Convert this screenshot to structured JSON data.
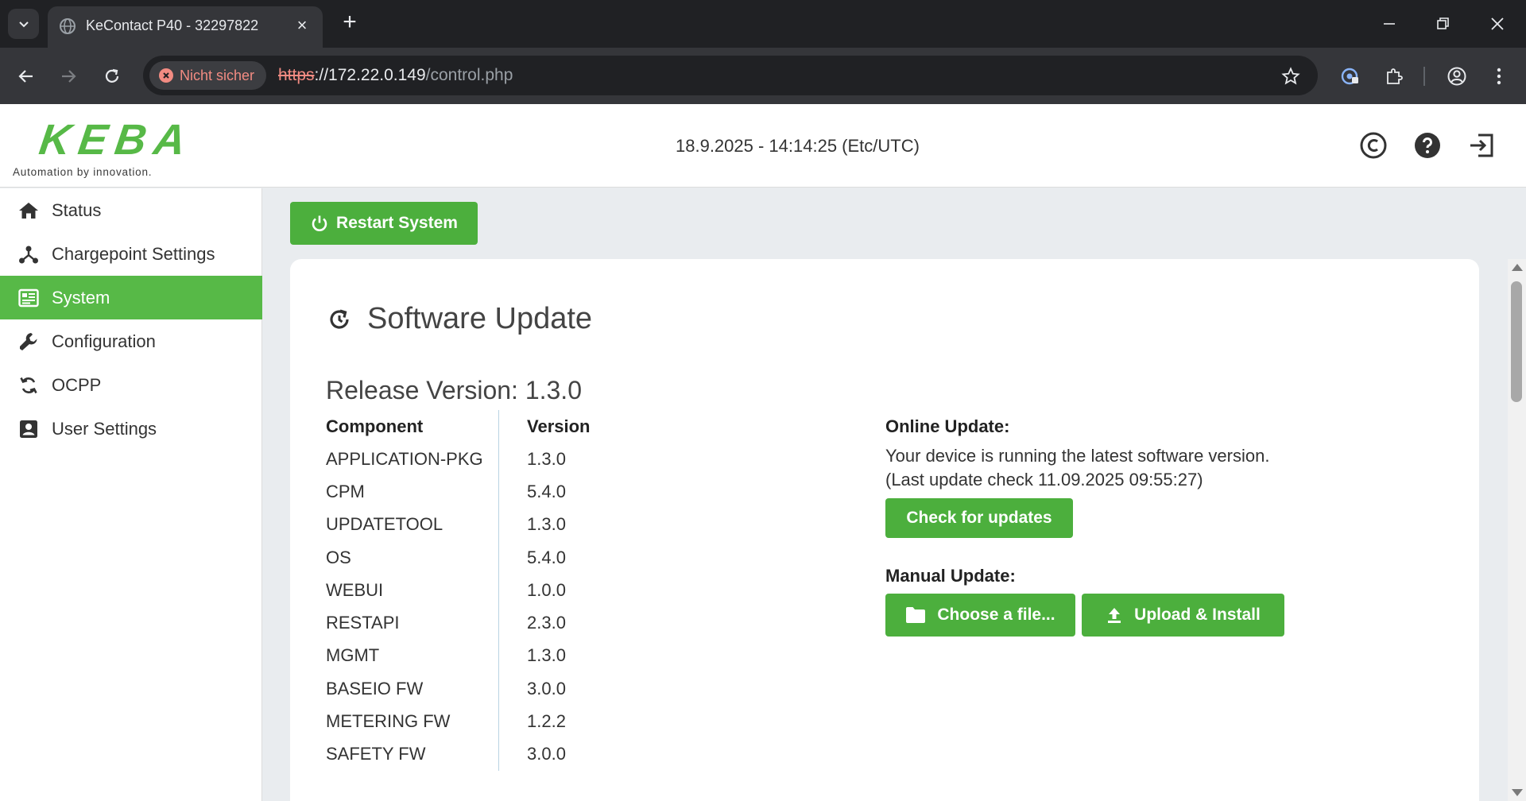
{
  "browser": {
    "tab_title": "KeContact P40 - 32297822",
    "security_label": "Nicht sicher",
    "url_scheme": "https",
    "url_host": "://172.22.0.149",
    "url_path": "/control.php"
  },
  "header": {
    "logo_text": "KEBA",
    "logo_tagline": "Automation by innovation.",
    "datetime": "18.9.2025 - 14:14:25 (Etc/UTC)",
    "icons": [
      "copyright-icon",
      "help-icon",
      "logout-icon"
    ]
  },
  "sidebar": {
    "items": [
      {
        "label": "Status",
        "icon": "home-icon",
        "active": false
      },
      {
        "label": "Chargepoint Settings",
        "icon": "network-icon",
        "active": false
      },
      {
        "label": "System",
        "icon": "system-icon",
        "active": true
      },
      {
        "label": "Configuration",
        "icon": "wrench-icon",
        "active": false
      },
      {
        "label": "OCPP",
        "icon": "sync-icon",
        "active": false
      },
      {
        "label": "User Settings",
        "icon": "user-card-icon",
        "active": false
      }
    ]
  },
  "main": {
    "restart_label": "Restart System",
    "section_title": "Software Update",
    "release_version": "Release Version: 1.3.0",
    "table": {
      "headers": [
        "Component",
        "Version"
      ],
      "rows": [
        [
          "APPLICATION-PKG",
          "1.3.0"
        ],
        [
          "CPM",
          "5.4.0"
        ],
        [
          "UPDATETOOL",
          "1.3.0"
        ],
        [
          "OS",
          "5.4.0"
        ],
        [
          "WEBUI",
          "1.0.0"
        ],
        [
          "RESTAPI",
          "2.3.0"
        ],
        [
          "MGMT",
          "1.3.0"
        ],
        [
          "BASEIO FW",
          "3.0.0"
        ],
        [
          "METERING FW",
          "1.2.2"
        ],
        [
          "SAFETY FW",
          "3.0.0"
        ]
      ]
    },
    "online_update": {
      "heading": "Online Update:",
      "message": "Your device is running the latest software version.",
      "last_check": "(Last update check 11.09.2025 09:55:27)",
      "button": "Check for updates"
    },
    "manual_update": {
      "heading": "Manual Update:",
      "choose_button": "Choose a file...",
      "upload_button": "Upload & Install"
    }
  },
  "colors": {
    "brand_green": "#57b947",
    "button_green": "#4caf3d"
  }
}
